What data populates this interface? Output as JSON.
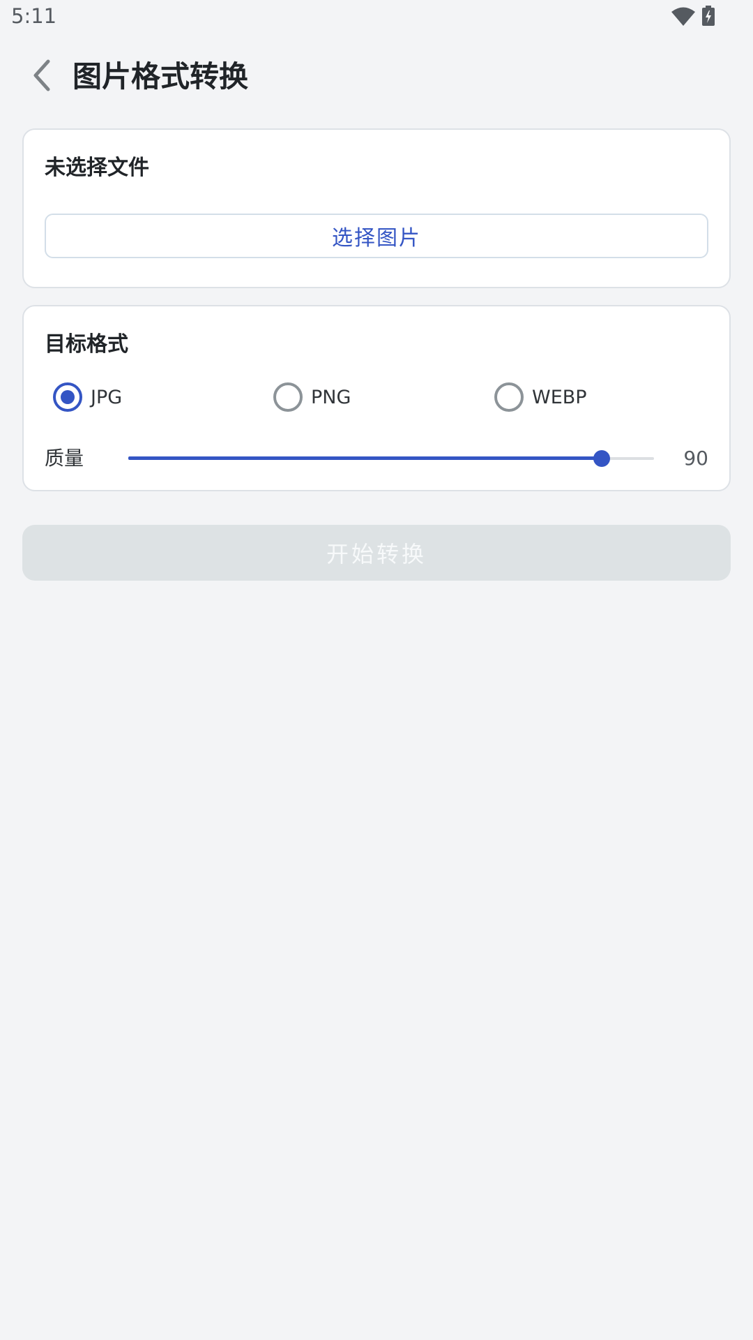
{
  "status_bar": {
    "time": "5:11",
    "icons": [
      "wifi-icon",
      "battery-charging-icon"
    ]
  },
  "header": {
    "title": "图片格式转换",
    "back_icon": "chevron-left-icon"
  },
  "file_section": {
    "status": "未选择文件",
    "select_button_label": "选择图片"
  },
  "format_section": {
    "title": "目标格式",
    "options": [
      {
        "label": "JPG",
        "checked": true
      },
      {
        "label": "PNG",
        "checked": false
      },
      {
        "label": "WEBP",
        "checked": false
      }
    ],
    "quality_label": "质量",
    "quality_value": "90",
    "quality_fraction": 0.9
  },
  "start_button_label": "开始转换",
  "colors": {
    "accent": "#3455c4",
    "background": "#f3f4f6",
    "disabled_button": "#dde2e4"
  }
}
